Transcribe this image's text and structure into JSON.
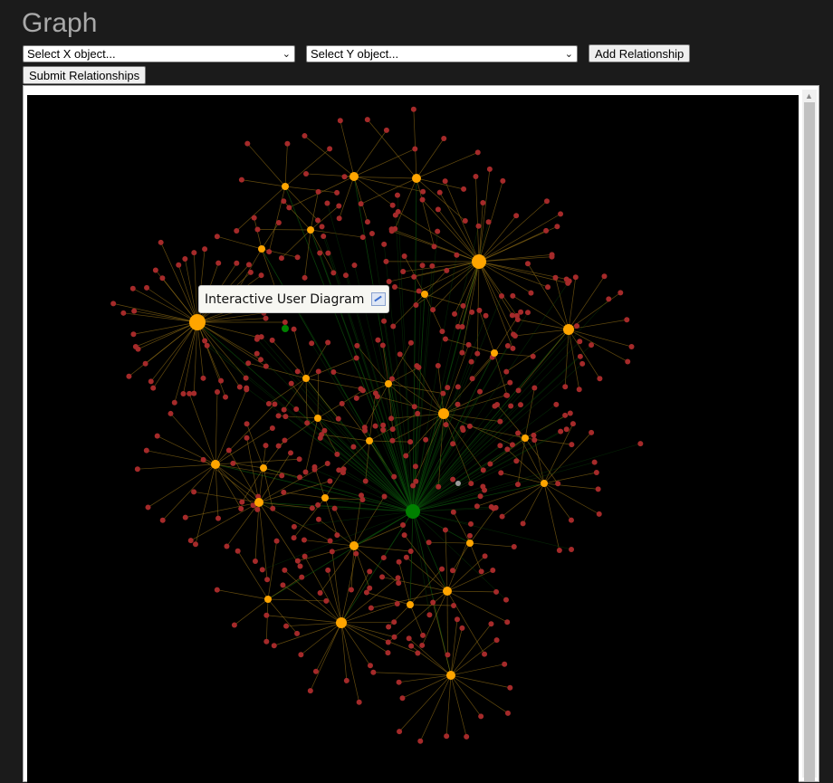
{
  "page": {
    "title": "Graph"
  },
  "controls": {
    "select_x": "Select X object...",
    "select_y": "Select Y object...",
    "add_relationship": "Add Relationship",
    "submit_relationships": "Submit Relationships"
  },
  "tooltip": {
    "text": "Interactive User Diagram",
    "icon": "chart-icon"
  },
  "colors": {
    "background": "#1b1b1b",
    "canvas": "#000000",
    "leaf_node": "#a52a2a",
    "hub_node": "#ffa500",
    "root_node": "#008000",
    "link": "#8b6914",
    "root_link": "#0b4f0b"
  }
}
